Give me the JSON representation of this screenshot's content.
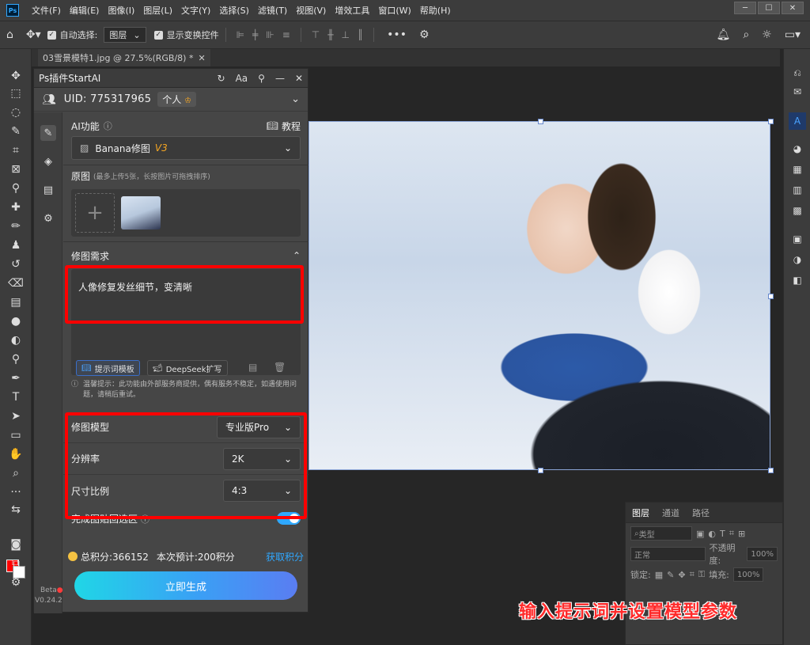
{
  "menubar": {
    "logo": "Ps",
    "items": [
      "文件(F)",
      "编辑(E)",
      "图像(I)",
      "图层(L)",
      "文字(Y)",
      "选择(S)",
      "滤镜(T)",
      "视图(V)",
      "增效工具",
      "窗口(W)",
      "帮助(H)"
    ]
  },
  "options": {
    "auto_select_label": "自动选择:",
    "auto_select_value": "图层",
    "show_transform_label": "显示变换控件"
  },
  "document": {
    "tab_title": "03雪景模特1.jpg @ 27.5%(RGB/8) *"
  },
  "plugin": {
    "title": "Ps插件StartAI",
    "uid_label": "UID: 775317965",
    "tier": "个人",
    "ai_function_label": "AI功能",
    "tutorial_label": "教程",
    "ai_function_value": "Banana修图",
    "ai_function_version": "V3",
    "original_label": "原图",
    "original_hint": "(最多上传5张，长按图片可拖拽排序)",
    "requirement_label": "修图需求",
    "prompt_text": "人像修复发丝细节，变清晰",
    "template_btn": "提示词模板",
    "deepseek_btn": "DeepSeek扩写",
    "notice": "温馨提示：此功能由外部服务商提供，偶有服务不稳定，如遇使用问题，请稍后重试。",
    "model_label": "修图模型",
    "model_value": "专业版Pro",
    "resolution_label": "分辨率",
    "resolution_value": "2K",
    "ratio_label": "尺寸比例",
    "ratio_value": "4:3",
    "paste_label": "完成图贴回选区",
    "paste_enabled": true,
    "points_total": "总积分:366152",
    "points_estimate": "本次预计:200积分",
    "get_points": "获取积分",
    "generate_btn": "立即生成",
    "beta_label": "Beta",
    "version_label": "V0.24.2"
  },
  "layers": {
    "tabs": [
      "图层",
      "通道",
      "路径"
    ],
    "filter_label": "类型",
    "blend_mode": "正常",
    "opacity_label": "不透明度:",
    "opacity_value": "100%",
    "lock_label": "锁定:",
    "fill_label": "填充:",
    "fill_value": "100%"
  },
  "caption": "输入提示词并设置模型参数",
  "colors": {
    "foreground": "#ff0000",
    "background": "#ffffff",
    "accent": "#2fa8ff",
    "highlight": "#ff0000"
  }
}
